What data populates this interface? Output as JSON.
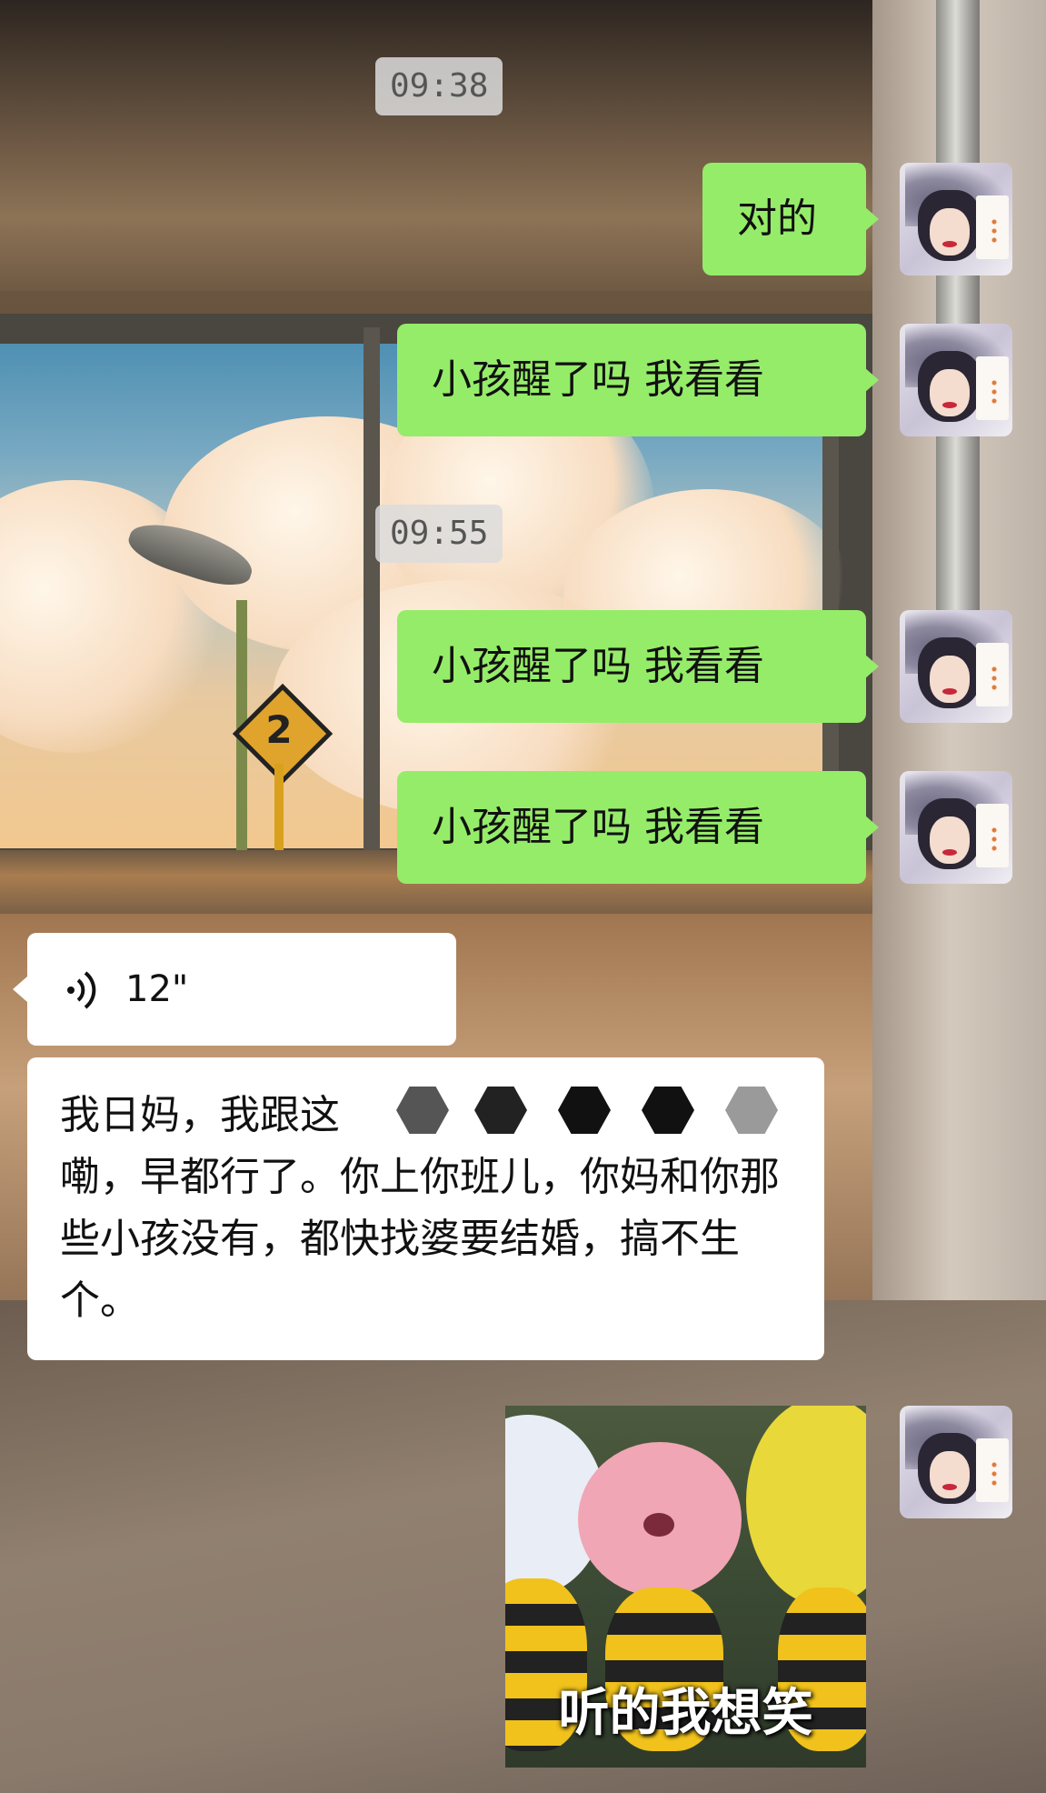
{
  "timestamps": [
    "09:38",
    "09:55"
  ],
  "messages": {
    "m1": "对的",
    "m2": "小孩醒了吗 我看看",
    "m3": "小孩醒了吗 我看看",
    "m4": "小孩醒了吗 我看看",
    "voice_duration": "12\"",
    "transcript_visible_start": "我日妈，我跟这",
    "transcript_rest": "嘞，早都行了。你上你班儿，你妈和你那些小孩没有，都快找婆要结婚，搞不生个。",
    "sticker_caption": "听的我想笑"
  },
  "wallpaper_sign_number": "2",
  "colors": {
    "outgoing_bubble": "#95ec69",
    "incoming_bubble": "#ffffff",
    "timestamp_bg": "#dcdcdc"
  },
  "icons": {
    "voice": "voice-wave-icon",
    "avatar": "user-avatar"
  }
}
